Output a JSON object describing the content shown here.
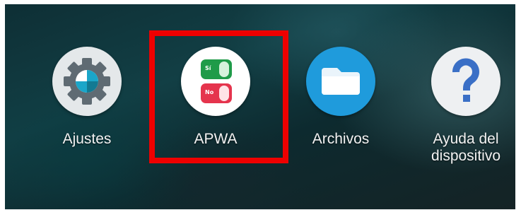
{
  "launcher": {
    "apps": [
      {
        "label": "Ajustes",
        "icon": "settings-gear-icon"
      },
      {
        "label": "APWA",
        "icon": "yes-no-toggle-icon",
        "toggle_yes": "Sí",
        "toggle_no": "No"
      },
      {
        "label": "Archivos",
        "icon": "folder-icon"
      },
      {
        "label": "Ayuda del dispositivo",
        "icon": "question-mark-icon"
      }
    ],
    "highlighted_app": "APWA"
  },
  "colors": {
    "highlight": "#ee0000",
    "files_blue": "#1f9bdc",
    "toggle_yes": "#1f9b49",
    "toggle_no": "#e5344d",
    "help_blue": "#3a6fc6"
  }
}
